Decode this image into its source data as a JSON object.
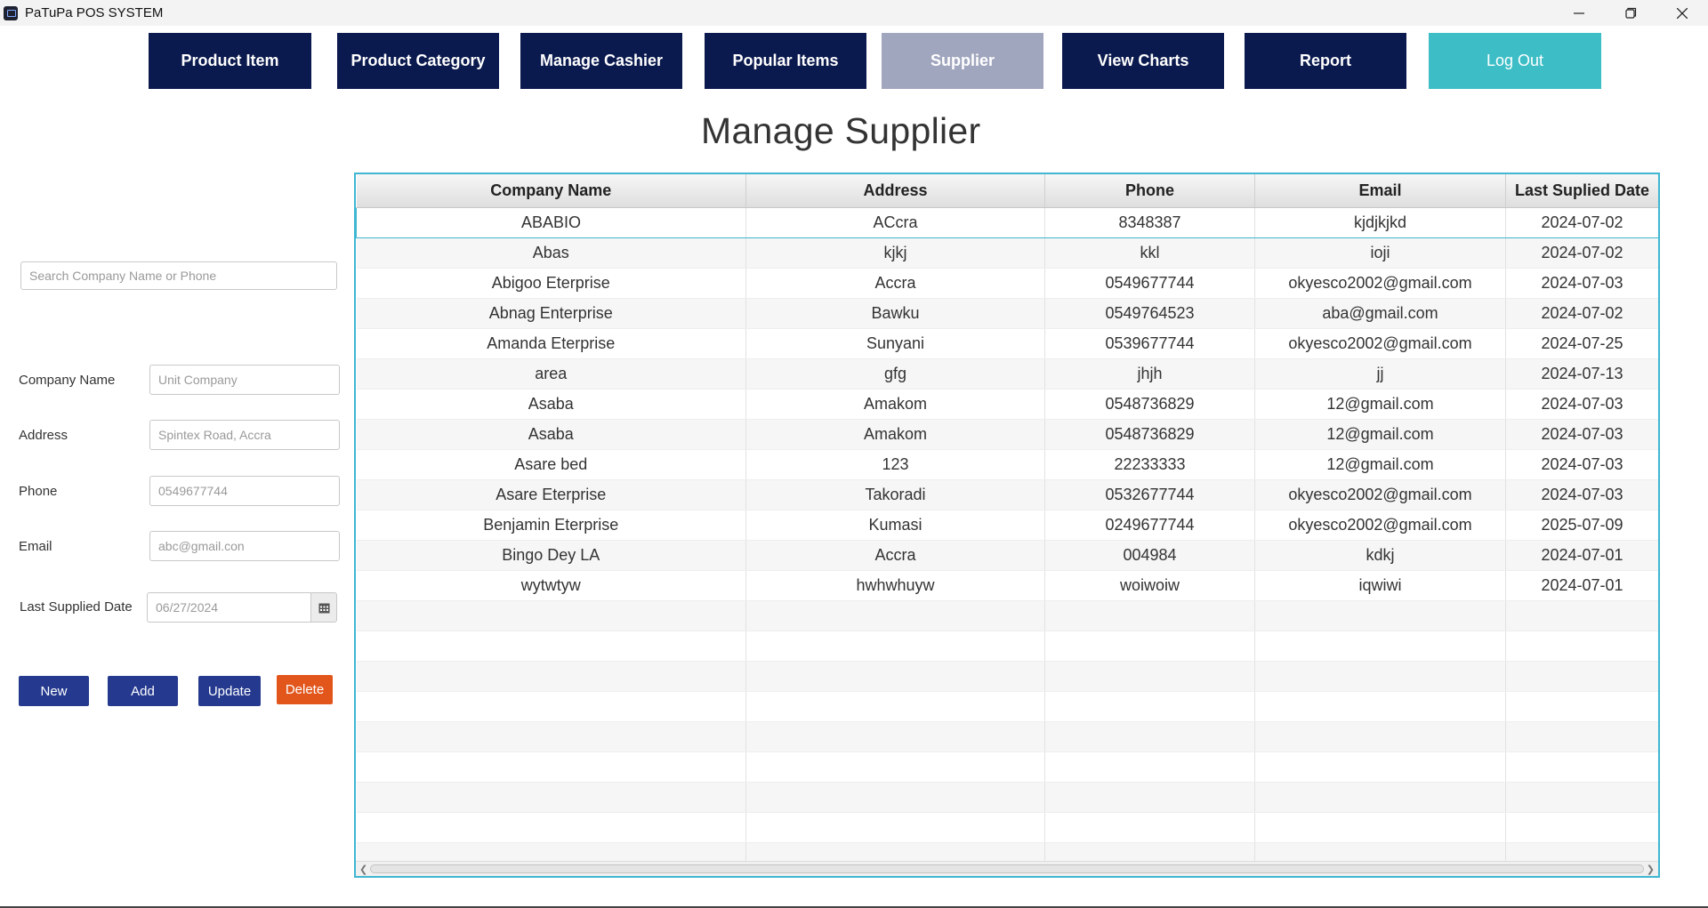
{
  "window": {
    "title": "PaTuPa POS SYSTEM"
  },
  "nav": {
    "product_item": "Product Item",
    "product_category": "Product Category",
    "manage_cashier": "Manage Cashier",
    "popular_items": "Popular Items",
    "supplier": "Supplier",
    "view_charts": "View Charts",
    "report": "Report",
    "log_out": "Log Out",
    "active": "Supplier"
  },
  "page": {
    "title": "Manage Supplier"
  },
  "search": {
    "placeholder": "Search Company Name or Phone"
  },
  "form": {
    "company_name_label": "Company Name",
    "company_name_placeholder": "Unit Company",
    "address_label": "Address",
    "address_placeholder": "Spintex Road, Accra",
    "phone_label": "Phone",
    "phone_placeholder": "0549677744",
    "email_label": "Email",
    "email_placeholder": "abc@gmail.con",
    "date_label": "Last Supplied Date",
    "date_placeholder": "06/27/2024"
  },
  "actions": {
    "new": "New",
    "add": "Add",
    "update": "Update",
    "delete": "Delete"
  },
  "table": {
    "columns": [
      "Company Name",
      "Address",
      "Phone",
      "Email",
      "Last Suplied Date"
    ],
    "rows": [
      [
        "ABABIO",
        "ACcra",
        "8348387",
        "kjdjkjkd",
        "2024-07-02"
      ],
      [
        "Abas",
        "kjkj",
        "kkl",
        "ioji",
        "2024-07-02"
      ],
      [
        "Abigoo Eterprise",
        "Accra",
        "0549677744",
        "okyesco2002@gmail.com",
        "2024-07-03"
      ],
      [
        "Abnag Enterprise",
        "Bawku",
        "0549764523",
        "aba@gmail.com",
        "2024-07-02"
      ],
      [
        "Amanda Eterprise",
        "Sunyani",
        "0539677744",
        "okyesco2002@gmail.com",
        "2024-07-25"
      ],
      [
        "area",
        "gfg",
        "jhjh",
        "jj",
        "2024-07-13"
      ],
      [
        "Asaba",
        "Amakom",
        "0548736829",
        "12@gmail.com",
        "2024-07-03"
      ],
      [
        "Asaba",
        "Amakom",
        "0548736829",
        "12@gmail.com",
        "2024-07-03"
      ],
      [
        "Asare bed",
        "123",
        "22233333",
        "12@gmail.com",
        "2024-07-03"
      ],
      [
        "Asare Eterprise",
        "Takoradi",
        "0532677744",
        "okyesco2002@gmail.com",
        "2024-07-03"
      ],
      [
        "Benjamin Eterprise",
        "Kumasi",
        "0249677744",
        "okyesco2002@gmail.com",
        "2025-07-09"
      ],
      [
        "Bingo Dey LA",
        "Accra",
        "004984",
        "kdkj",
        "2024-07-01"
      ],
      [
        "wytwtyw",
        "hwhwhuyw",
        "woiwoiw",
        "iqwiwi",
        "2024-07-01"
      ]
    ],
    "selected_row": 0
  },
  "colors": {
    "nav_bg": "#0b1a4e",
    "nav_active": "#a0a6be",
    "logout": "#3dbec6",
    "action_btn": "#253a8f",
    "delete_btn": "#e2561c",
    "table_border": "#3fb6d2"
  }
}
